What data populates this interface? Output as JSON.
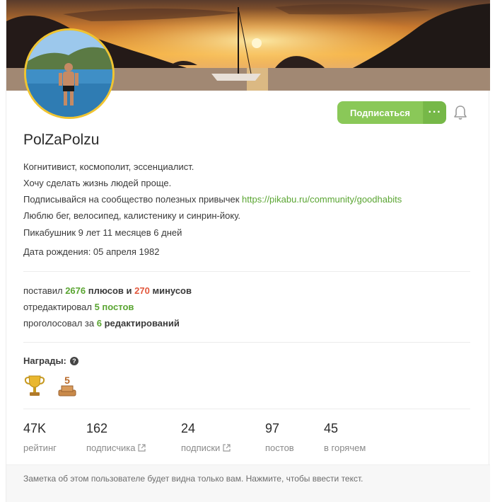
{
  "profile": {
    "username": "PolZaPolzu",
    "bio_lines": [
      "Когнитивист, космополит, эссенциалист.",
      "Хочу сделать жизнь людей проще."
    ],
    "bio_link_prefix": "Подписывайся на сообщество полезных привычек ",
    "bio_link_url": "https://pikabu.ru/community/goodhabits",
    "bio_last_line": "Люблю бег, велосипед, калистенику и синрин-йоку.",
    "tenure": "Пикабушник 9 лет 11 месяцев 6 дней",
    "birthday": "Дата рождения: 05 апреля 1982"
  },
  "actions": {
    "subscribe_label": "Подписаться",
    "more_label": "···",
    "bell_icon": "bell-icon"
  },
  "stats": {
    "plus_prefix": "поставил ",
    "plus_count": "2676",
    "plus_mid": " плюсов и ",
    "minus_count": "270",
    "minus_suffix": " минусов",
    "edited_prefix": "отредактировал ",
    "edited_value": "5 постов",
    "voted_prefix": "проголосовал за ",
    "voted_count": "6",
    "voted_suffix": " редактирований"
  },
  "awards": {
    "title": "Награды:",
    "help_icon": "?",
    "items": [
      "trophy-icon",
      "five-years-medal-icon"
    ]
  },
  "counters": [
    {
      "value": "47K",
      "label": "рейтинг",
      "external": false
    },
    {
      "value": "162",
      "label": "подписчика",
      "external": true
    },
    {
      "value": "24",
      "label": "подписки",
      "external": true
    },
    {
      "value": "97",
      "label": "постов",
      "external": false
    },
    {
      "value": "45",
      "label": "в горячем",
      "external": false
    }
  ],
  "note": {
    "text": "Заметка об этом пользователе будет видна только вам. Нажмите, чтобы ввести текст."
  },
  "colors": {
    "accent_green": "#8ac858",
    "link_green": "#5aa532",
    "minus_red": "#e2573c",
    "avatar_border": "#f0c430"
  }
}
